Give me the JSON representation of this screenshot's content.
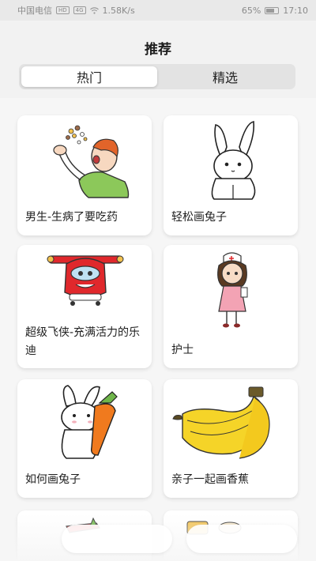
{
  "status_bar": {
    "carrier": "中国电信",
    "hd_badge": "HD",
    "network_badge": "4G",
    "speed": "1.58K/s",
    "battery": "65%",
    "time": "17:10"
  },
  "header": {
    "title": "推荐",
    "tabs": [
      {
        "label": "热门",
        "active": true
      },
      {
        "label": "精选",
        "active": false
      }
    ]
  },
  "cards": [
    {
      "caption": "男生-生病了要吃药",
      "icon": "sick-boy-taking-pills-drawing"
    },
    {
      "caption": "轻松画兔子",
      "icon": "rabbit-drawing"
    },
    {
      "caption": "超级飞侠-充满活力的乐迪",
      "icon": "super-wings-jett-drawing"
    },
    {
      "caption": "护士",
      "icon": "nurse-drawing"
    },
    {
      "caption": "如何画兔子",
      "icon": "rabbit-with-carrot-drawing"
    },
    {
      "caption": "亲子一起画香蕉",
      "icon": "banana-bunch-drawing"
    },
    {
      "caption": "",
      "icon": "airplane-drawing"
    },
    {
      "caption": "",
      "icon": "food-drawing"
    }
  ],
  "colors": {
    "background": "#f2f2f2",
    "card": "#ffffff",
    "banana": "#f5d428",
    "plane_red": "#e0282c",
    "carrot": "#f07a1e",
    "nurse_pink": "#f3a3b4"
  }
}
